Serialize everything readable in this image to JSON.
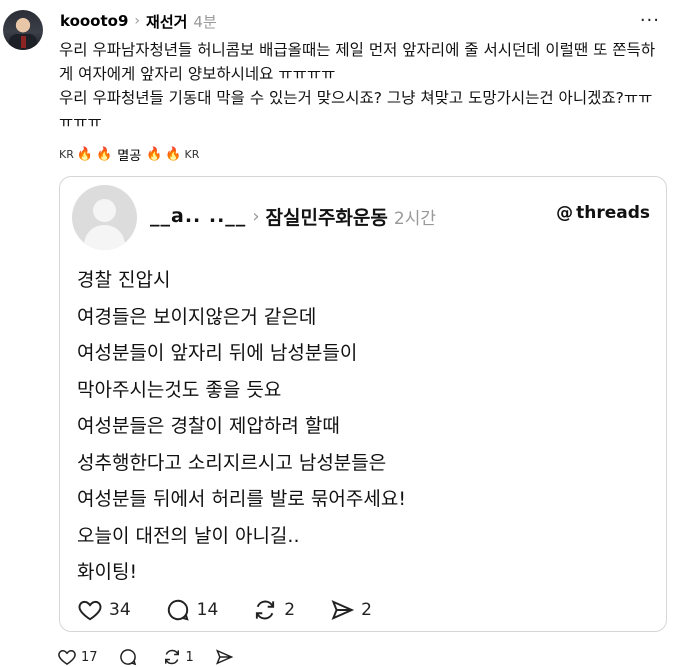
{
  "post": {
    "username": "koooto9",
    "chevron": "›",
    "repost_title": "재선거",
    "time": "4분",
    "more": "···",
    "body": "우리 우파남자청년들 허니콤보 배급올때는 제일 먼저 앞자리에 줄 서시던데 이럴땐 또 쫀득하게 여자에게 앞자리 양보하시네요 ㅠㅠㅠㅠ\n우리 우파청년들 기동대 막을 수 있는거 맞으시죠? 그냥 쳐맞고 도망가시는건 아니겠죠?ㅠㅠㅠㅠㅠ",
    "tags": {
      "kr_left": "KR",
      "fire": "🔥",
      "word": "멸공",
      "kr_right": "KR"
    }
  },
  "quoted": {
    "username": "__a.. ..__",
    "chevron": "›",
    "title": "잠실민주화운동",
    "time": "2시간",
    "brand": "threads",
    "brand_icon": "@",
    "lines": [
      "경찰 진압시",
      "여경들은 보이지않은거 같은데",
      "여성분들이 앞자리 뒤에 남성분들이",
      "막아주시는것도 좋을 듯요",
      "여성분들은 경찰이 제압하려 할때",
      "성추행한다고 소리지르시고 남성분들은",
      "여성분들 뒤에서 허리를 발로 묶어주세요!",
      "오늘이 대전의 날이 아니길..",
      "화이팅!"
    ],
    "actions": {
      "likes": "34",
      "replies": "14",
      "reposts": "2",
      "shares": "2"
    }
  },
  "footer": {
    "likes": "17",
    "replies": "",
    "reposts": "1",
    "shares": ""
  },
  "icons": {
    "like": "heart-icon",
    "reply": "comment-icon",
    "repost": "repost-icon",
    "share": "send-icon"
  }
}
